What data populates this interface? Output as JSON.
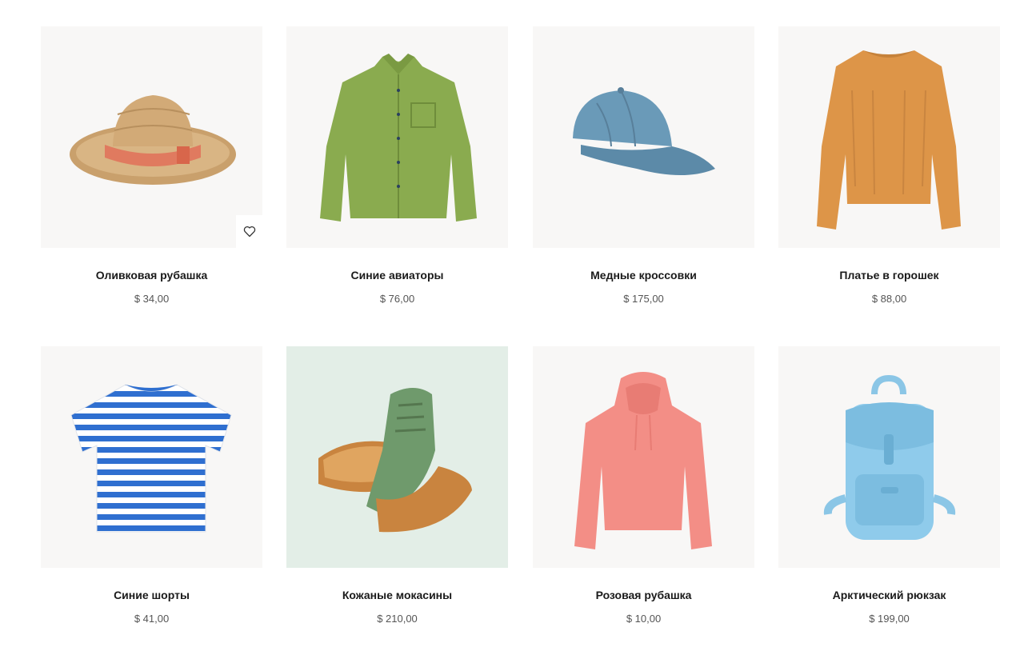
{
  "products": [
    {
      "title": "Оливковая рубашка",
      "price": "$ 34,00",
      "image": "straw-hat",
      "favorite_icon": "heart-outline-icon"
    },
    {
      "title": "Синие авиаторы",
      "price": "$ 76,00",
      "image": "green-shirt"
    },
    {
      "title": "Медные кроссовки",
      "price": "$ 175,00",
      "image": "blue-cap"
    },
    {
      "title": "Платье в горошек",
      "price": "$ 88,00",
      "image": "orange-sweater"
    },
    {
      "title": "Синие шорты",
      "price": "$ 41,00",
      "image": "striped-tshirt"
    },
    {
      "title": "Кожаные мокасины",
      "price": "$ 210,00",
      "image": "green-sneakers"
    },
    {
      "title": "Розовая рубашка",
      "price": "$ 10,00",
      "image": "pink-hoodie"
    },
    {
      "title": "Арктический рюкзак",
      "price": "$ 199,00",
      "image": "blue-backpack"
    }
  ],
  "colors": {
    "thumb_bg": "#f8f7f6",
    "thumb_bg_mint": "#e3eee7",
    "price_text": "#555555",
    "title_text": "#1a1a1a"
  }
}
